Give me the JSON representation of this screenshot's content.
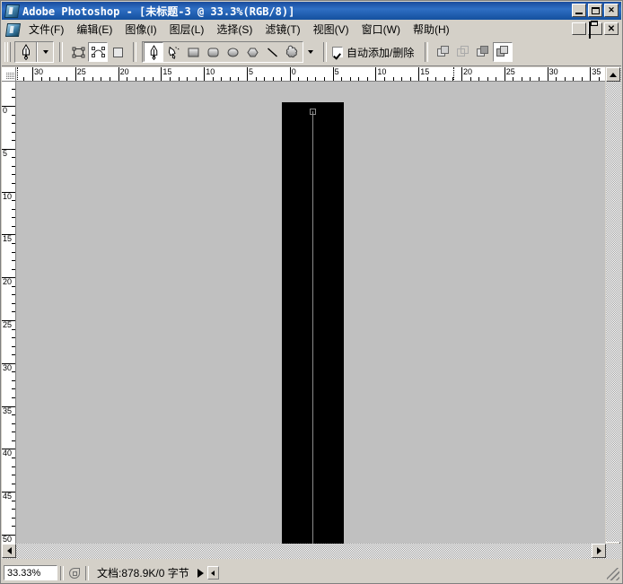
{
  "window": {
    "title": "Adobe Photoshop - [未标题-3 @ 33.3%(RGB/8)]",
    "app_icon": "photoshop-icon",
    "buttons": {
      "minimize": "minimize-icon",
      "maximize": "maximize-icon",
      "close": "close-icon"
    }
  },
  "menubar": {
    "doc_icon": "document-icon",
    "items": [
      {
        "label": "文件(F)"
      },
      {
        "label": "编辑(E)"
      },
      {
        "label": "图像(I)"
      },
      {
        "label": "图层(L)"
      },
      {
        "label": "选择(S)"
      },
      {
        "label": "滤镜(T)"
      },
      {
        "label": "视图(V)"
      },
      {
        "label": "窗口(W)"
      },
      {
        "label": "帮助(H)"
      }
    ],
    "mdi_buttons": {
      "minimize": "mdi-minimize-icon",
      "restore": "mdi-restore-icon",
      "close": "mdi-close-icon"
    }
  },
  "options_bar": {
    "current_tool": "pen-tool-icon",
    "current_tool_dropdown": "chevron-down-icon",
    "mode_group": [
      {
        "name": "shape-layers-mode",
        "icon": "shape-layer-icon",
        "active": false
      },
      {
        "name": "paths-mode",
        "icon": "path-icon",
        "active": true
      },
      {
        "name": "fill-pixels-mode",
        "icon": "filled-square-icon",
        "active": false
      }
    ],
    "tool_group": [
      {
        "name": "pen-tool",
        "icon": "pen-icon",
        "active": true
      },
      {
        "name": "freeform-pen-tool",
        "icon": "freeform-pen-icon",
        "active": false
      },
      {
        "name": "rectangle-tool",
        "icon": "rectangle-icon",
        "active": false
      },
      {
        "name": "rounded-rectangle-tool",
        "icon": "rounded-rectangle-icon",
        "active": false
      },
      {
        "name": "ellipse-tool",
        "icon": "ellipse-icon",
        "active": false
      },
      {
        "name": "polygon-tool",
        "icon": "polygon-icon",
        "active": false
      },
      {
        "name": "line-tool",
        "icon": "line-icon",
        "active": false
      },
      {
        "name": "custom-shape-tool",
        "icon": "custom-shape-icon",
        "active": false
      }
    ],
    "geometry_dropdown": "chevron-down-icon",
    "auto_add_delete": {
      "label": "自动添加/删除",
      "checked": true
    },
    "path_ops": [
      {
        "name": "add-to-path-area",
        "icon": "add-shape-icon",
        "active": false
      },
      {
        "name": "subtract-from-path-area",
        "icon": "subtract-shape-icon",
        "active": false
      },
      {
        "name": "intersect-path-areas",
        "icon": "intersect-shape-icon",
        "active": false
      },
      {
        "name": "exclude-overlapping-path-areas",
        "icon": "exclude-shape-icon",
        "active": true
      }
    ]
  },
  "rulers": {
    "unit": "cm",
    "horizontal_labels": [
      "30",
      "25",
      "20",
      "15",
      "10",
      "5",
      "0",
      "5",
      "10",
      "15",
      "20",
      "25",
      "30",
      "35"
    ],
    "vertical_labels": [
      "0",
      "5",
      "10",
      "15",
      "20",
      "25",
      "30",
      "35",
      "40",
      "45",
      "50"
    ],
    "origin_marker": "ruler-origin-icon"
  },
  "canvas": {
    "background_color": "#c0c0c0",
    "document_color": "#000000",
    "path_color": "#8c8c8c",
    "anchors": [
      {
        "name": "path-anchor-top",
        "type": "open",
        "selected": false
      },
      {
        "name": "path-anchor-bottom",
        "type": "filled",
        "selected": true
      }
    ]
  },
  "scrollbars": {
    "vertical_up": "scroll-up-arrow-icon",
    "vertical_down": "scroll-down-arrow-icon",
    "horizontal_left": "scroll-left-arrow-icon",
    "horizontal_right": "scroll-right-arrow-icon"
  },
  "statusbar": {
    "zoom_value": "33.33%",
    "preview_icon": "document-preview-icon",
    "doc_info": "文档:878.9K/0 字节",
    "menu_arrow": "status-menu-arrow-icon",
    "resize_grip": "resize-grip-icon"
  }
}
